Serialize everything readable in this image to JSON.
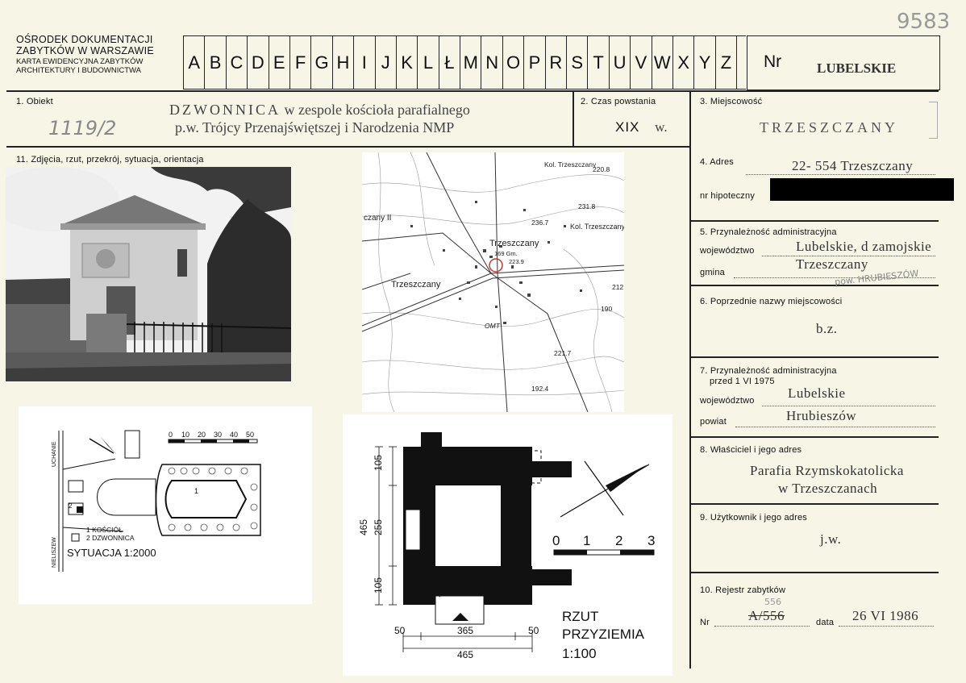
{
  "header": {
    "stamp_number": "9583",
    "institution_line1": "OŚRODEK DOKUMENTACJI",
    "institution_line2": "ZABYTKÓW W WARSZAWIE",
    "card_line1": "KARTA EWIDENCYJNA ZABYTKÓW",
    "card_line2": "ARCHITEKTURY I BUDOWNICTWA",
    "letters": [
      "A",
      "B",
      "C",
      "D",
      "E",
      "F",
      "G",
      "H",
      "I",
      "J",
      "K",
      "L",
      "Ł",
      "M",
      "N",
      "O",
      "P",
      "R",
      "S",
      "T",
      "U",
      "V",
      "W",
      "X",
      "Y",
      "Z"
    ],
    "nr_label": "Nr",
    "region": "LUBELSKIE"
  },
  "field1": {
    "label": "1. Obiekt",
    "handwritten_code": "1119/2",
    "object_main": "DZWONNICA",
    "object_rest": "w zespole kościoła parafialnego",
    "object_line2": "p.w. Trójcy Przenajświętszej i Narodzenia NMP"
  },
  "field2": {
    "label": "2. Czas powstania",
    "century": "XIX",
    "suffix": "w."
  },
  "field3": {
    "label": "3. Miejscowość",
    "value": "TRZESZCZANY"
  },
  "field4": {
    "label": "4. Adres",
    "value": "22- 554 Trzeszczany",
    "hypo_label": "nr hipoteczny"
  },
  "field5": {
    "label": "5. Przynależność administracyjna",
    "voiv_label": "województwo",
    "voiv_value": "Lubelskie, d zamojskie",
    "gmina_label": "gmina",
    "gmina_value": "Trzeszczany",
    "handwritten_note": "pow. HRUBIESZÓW"
  },
  "field6": {
    "label": "6. Poprzednie nazwy miejscowości",
    "value": "b.z."
  },
  "field7": {
    "label": "7. Przynależność administracyjna",
    "sublabel": "przed 1 VI 1975",
    "voiv_label": "województwo",
    "voiv_value": "Lubelskie",
    "powiat_label": "powiat",
    "powiat_value": "Hrubieszów"
  },
  "field8": {
    "label": "8. Właściciel i jego adres",
    "line1": "Parafia Rzymskokatolicka",
    "line2": "w Trzeszczanach"
  },
  "field9": {
    "label": "9. Użytkownik i jego adres",
    "value": "j.w."
  },
  "field10": {
    "label": "10. Rejestr zabytków",
    "nr_label": "Nr",
    "nr_value": "A/556",
    "nr_correction": "556",
    "data_label": "data",
    "data_value": "26 VI 1986"
  },
  "field11": {
    "label": "11. Zdjęcia, rzut, przekrój, sytuacja, orientacja"
  },
  "map": {
    "labels": [
      "Kol. Trzeszczany",
      "220.8",
      "231.8",
      "czany II",
      "236.7",
      "Kol. Trzeszczany",
      "Trzeszczany",
      "169 Gm.",
      "223.9",
      "Trzeszczany",
      "212",
      "190",
      "OMT",
      "221.7",
      "192.4"
    ]
  },
  "situation": {
    "scale_ticks": [
      "0",
      "10",
      "20",
      "30",
      "40",
      "50"
    ],
    "street_top": "UCHANIE",
    "street_left": "NIELISZEW",
    "legend1": "1 KOŚCIÓŁ",
    "legend2": "2 DZWONNICA",
    "church_num": "1",
    "belfry_num": "2",
    "title": "SYTUACJA 1:2000"
  },
  "plan": {
    "dims_left": [
      "105",
      "255",
      "105"
    ],
    "dim_total_left": "465",
    "dims_bottom": [
      "50",
      "365",
      "50"
    ],
    "dim_total_bottom": "465",
    "scale_ticks": [
      "0",
      "1",
      "2",
      "3"
    ],
    "title_line1": "RZUT",
    "title_line2": "PRZYZIEMIA",
    "title_line3": "1:100"
  }
}
